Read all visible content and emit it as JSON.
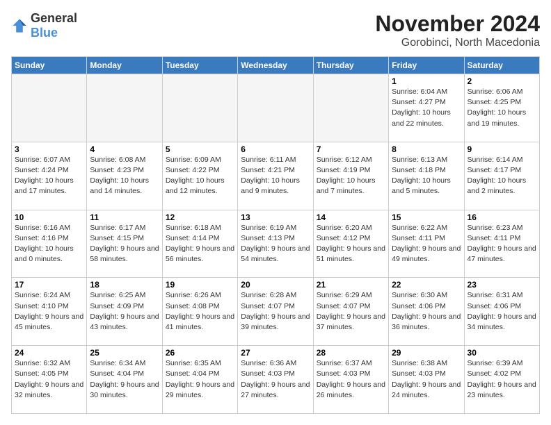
{
  "logo": {
    "general": "General",
    "blue": "Blue"
  },
  "header": {
    "month": "November 2024",
    "location": "Gorobinci, North Macedonia"
  },
  "weekdays": [
    "Sunday",
    "Monday",
    "Tuesday",
    "Wednesday",
    "Thursday",
    "Friday",
    "Saturday"
  ],
  "weeks": [
    [
      {
        "day": "",
        "info": ""
      },
      {
        "day": "",
        "info": ""
      },
      {
        "day": "",
        "info": ""
      },
      {
        "day": "",
        "info": ""
      },
      {
        "day": "",
        "info": ""
      },
      {
        "day": "1",
        "info": "Sunrise: 6:04 AM\nSunset: 4:27 PM\nDaylight: 10 hours and 22 minutes."
      },
      {
        "day": "2",
        "info": "Sunrise: 6:06 AM\nSunset: 4:25 PM\nDaylight: 10 hours and 19 minutes."
      }
    ],
    [
      {
        "day": "3",
        "info": "Sunrise: 6:07 AM\nSunset: 4:24 PM\nDaylight: 10 hours and 17 minutes."
      },
      {
        "day": "4",
        "info": "Sunrise: 6:08 AM\nSunset: 4:23 PM\nDaylight: 10 hours and 14 minutes."
      },
      {
        "day": "5",
        "info": "Sunrise: 6:09 AM\nSunset: 4:22 PM\nDaylight: 10 hours and 12 minutes."
      },
      {
        "day": "6",
        "info": "Sunrise: 6:11 AM\nSunset: 4:21 PM\nDaylight: 10 hours and 9 minutes."
      },
      {
        "day": "7",
        "info": "Sunrise: 6:12 AM\nSunset: 4:19 PM\nDaylight: 10 hours and 7 minutes."
      },
      {
        "day": "8",
        "info": "Sunrise: 6:13 AM\nSunset: 4:18 PM\nDaylight: 10 hours and 5 minutes."
      },
      {
        "day": "9",
        "info": "Sunrise: 6:14 AM\nSunset: 4:17 PM\nDaylight: 10 hours and 2 minutes."
      }
    ],
    [
      {
        "day": "10",
        "info": "Sunrise: 6:16 AM\nSunset: 4:16 PM\nDaylight: 10 hours and 0 minutes."
      },
      {
        "day": "11",
        "info": "Sunrise: 6:17 AM\nSunset: 4:15 PM\nDaylight: 9 hours and 58 minutes."
      },
      {
        "day": "12",
        "info": "Sunrise: 6:18 AM\nSunset: 4:14 PM\nDaylight: 9 hours and 56 minutes."
      },
      {
        "day": "13",
        "info": "Sunrise: 6:19 AM\nSunset: 4:13 PM\nDaylight: 9 hours and 54 minutes."
      },
      {
        "day": "14",
        "info": "Sunrise: 6:20 AM\nSunset: 4:12 PM\nDaylight: 9 hours and 51 minutes."
      },
      {
        "day": "15",
        "info": "Sunrise: 6:22 AM\nSunset: 4:11 PM\nDaylight: 9 hours and 49 minutes."
      },
      {
        "day": "16",
        "info": "Sunrise: 6:23 AM\nSunset: 4:11 PM\nDaylight: 9 hours and 47 minutes."
      }
    ],
    [
      {
        "day": "17",
        "info": "Sunrise: 6:24 AM\nSunset: 4:10 PM\nDaylight: 9 hours and 45 minutes."
      },
      {
        "day": "18",
        "info": "Sunrise: 6:25 AM\nSunset: 4:09 PM\nDaylight: 9 hours and 43 minutes."
      },
      {
        "day": "19",
        "info": "Sunrise: 6:26 AM\nSunset: 4:08 PM\nDaylight: 9 hours and 41 minutes."
      },
      {
        "day": "20",
        "info": "Sunrise: 6:28 AM\nSunset: 4:07 PM\nDaylight: 9 hours and 39 minutes."
      },
      {
        "day": "21",
        "info": "Sunrise: 6:29 AM\nSunset: 4:07 PM\nDaylight: 9 hours and 37 minutes."
      },
      {
        "day": "22",
        "info": "Sunrise: 6:30 AM\nSunset: 4:06 PM\nDaylight: 9 hours and 36 minutes."
      },
      {
        "day": "23",
        "info": "Sunrise: 6:31 AM\nSunset: 4:06 PM\nDaylight: 9 hours and 34 minutes."
      }
    ],
    [
      {
        "day": "24",
        "info": "Sunrise: 6:32 AM\nSunset: 4:05 PM\nDaylight: 9 hours and 32 minutes."
      },
      {
        "day": "25",
        "info": "Sunrise: 6:34 AM\nSunset: 4:04 PM\nDaylight: 9 hours and 30 minutes."
      },
      {
        "day": "26",
        "info": "Sunrise: 6:35 AM\nSunset: 4:04 PM\nDaylight: 9 hours and 29 minutes."
      },
      {
        "day": "27",
        "info": "Sunrise: 6:36 AM\nSunset: 4:03 PM\nDaylight: 9 hours and 27 minutes."
      },
      {
        "day": "28",
        "info": "Sunrise: 6:37 AM\nSunset: 4:03 PM\nDaylight: 9 hours and 26 minutes."
      },
      {
        "day": "29",
        "info": "Sunrise: 6:38 AM\nSunset: 4:03 PM\nDaylight: 9 hours and 24 minutes."
      },
      {
        "day": "30",
        "info": "Sunrise: 6:39 AM\nSunset: 4:02 PM\nDaylight: 9 hours and 23 minutes."
      }
    ]
  ]
}
